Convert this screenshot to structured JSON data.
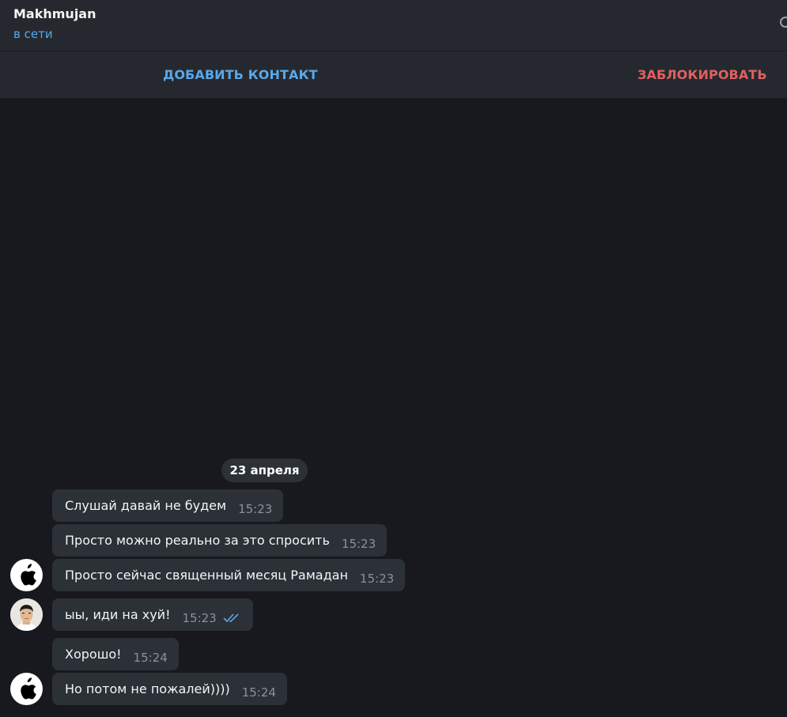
{
  "header": {
    "name": "Makhmujan",
    "status": "в сети",
    "search_icon": "search-icon"
  },
  "actions": {
    "add_contact": "ДОБАВИТЬ КОНТАКТ",
    "block": "ЗАБЛОКИРОВАТЬ"
  },
  "date_separator": "23 апреля",
  "messages": [
    {
      "text": "Слушай давай не будем",
      "time": "15:23"
    },
    {
      "text": "Просто можно реально за это спросить",
      "time": "15:23"
    },
    {
      "text": "Просто сейчас священный месяц Рамадан",
      "time": "15:23"
    },
    {
      "text": "ыы, иди на хуй!",
      "time": "15:23",
      "read": true
    },
    {
      "text": "Хорошо!",
      "time": "15:24"
    },
    {
      "text": "Но потом не пожалей))))",
      "time": "15:24"
    }
  ],
  "colors": {
    "background": "#17191e",
    "panel": "#25292f",
    "bubble": "#2c3037",
    "accent": "#5ba7e8",
    "danger": "#e16060"
  }
}
